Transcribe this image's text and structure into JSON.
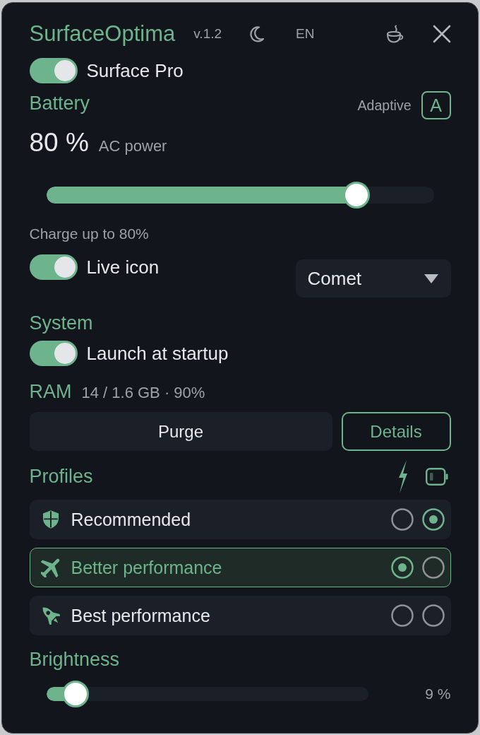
{
  "window": {
    "title": "SurfaceOptima",
    "version": "v.1.2",
    "language": "EN"
  },
  "device": {
    "label": "Surface Pro",
    "on": true
  },
  "battery": {
    "heading": "Battery",
    "mode_label": "Adaptive",
    "mode_button": "A",
    "charge": "80 %",
    "power_source": "AC power",
    "charge_limit": {
      "level": 0.8
    },
    "charge_limit_caption": "Charge up to 80%",
    "live_icon": {
      "label": "Live icon",
      "on": true
    },
    "icon_style": {
      "value": "Comet"
    }
  },
  "system": {
    "heading": "System",
    "launch_at_startup": {
      "label": "Launch at startup",
      "on": true
    },
    "ram": {
      "label": "RAM",
      "reading": "14 / 1.6 GB · 90%"
    },
    "buttons": [
      {
        "label": "Purge",
        "kind": "filled"
      },
      {
        "label": "Details",
        "kind": "outlined"
      }
    ]
  },
  "profiles": {
    "heading": "Profiles",
    "items": [
      {
        "label": "Recommended",
        "kind": "shield",
        "selected": false,
        "ac_checked": false,
        "battery_checked": true
      },
      {
        "label": "Better performance",
        "kind": "plane",
        "selected": true,
        "ac_checked": true,
        "battery_checked": false
      },
      {
        "label": "Best performance",
        "kind": "rocket",
        "selected": false,
        "ac_checked": false,
        "battery_checked": false
      }
    ]
  },
  "brightness": {
    "heading": "Brightness",
    "level": 0.09,
    "reading": "9 %"
  }
}
